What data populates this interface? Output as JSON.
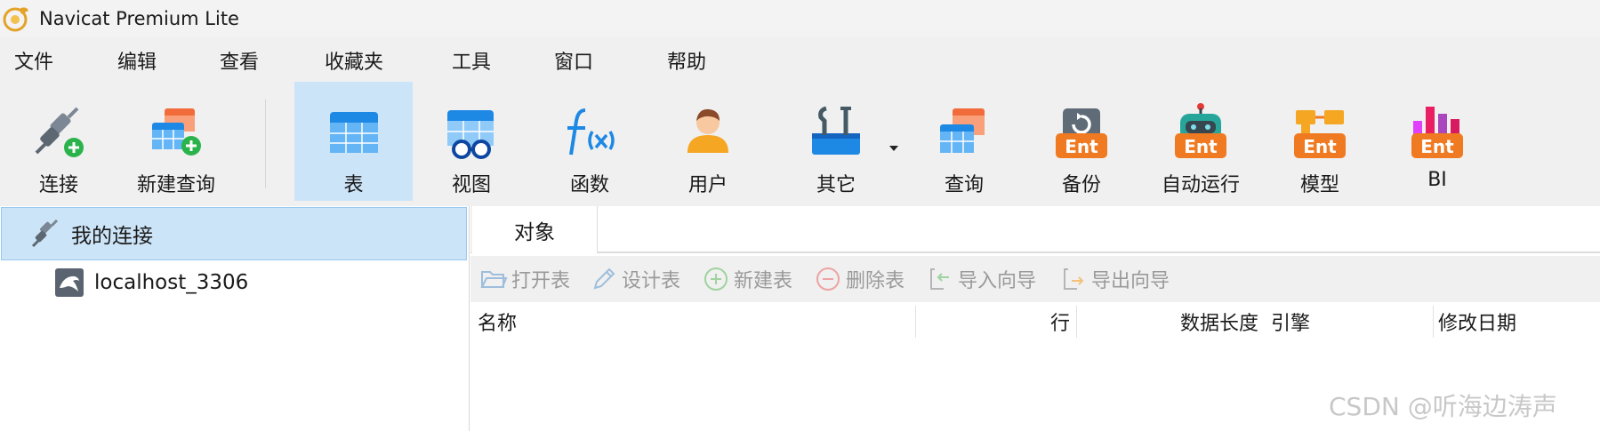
{
  "window": {
    "title": "Navicat Premium Lite"
  },
  "menu": [
    "文件",
    "编辑",
    "查看",
    "收藏夹",
    "工具",
    "窗口",
    "帮助"
  ],
  "toolbar": {
    "connect": "连接",
    "new_query": "新建查询",
    "table": "表",
    "view": "视图",
    "function": "函数",
    "user": "用户",
    "other": "其它",
    "query": "查询",
    "backup": "备份",
    "automation": "自动运行",
    "model": "模型",
    "bi": "BI",
    "ent_badge": "Ent"
  },
  "connections": {
    "root": "我的连接",
    "items": [
      "localhost_3306"
    ]
  },
  "tabs": {
    "object": "对象"
  },
  "object_toolbar": {
    "open_table": "打开表",
    "design_table": "设计表",
    "new_table": "新建表",
    "delete_table": "删除表",
    "import_wizard": "导入向导",
    "export_wizard": "导出向导"
  },
  "columns": {
    "name": "名称",
    "rows": "行",
    "data_length": "数据长度",
    "engine": "引擎",
    "modified_date": "修改日期"
  },
  "watermark": "CSDN @听海边涛声",
  "colors": {
    "selected_bg": "#cce4f7",
    "ent_orange": "#f07a22",
    "accent_blue": "#1e88e5"
  }
}
